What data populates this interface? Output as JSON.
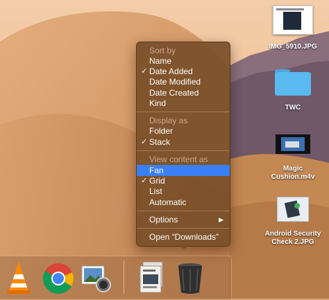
{
  "context_menu": {
    "sort_by": {
      "header": "Sort by",
      "items": [
        {
          "label": "Name",
          "checked": false
        },
        {
          "label": "Date Added",
          "checked": true
        },
        {
          "label": "Date Modified",
          "checked": false
        },
        {
          "label": "Date Created",
          "checked": false
        },
        {
          "label": "Kind",
          "checked": false
        }
      ]
    },
    "display_as": {
      "header": "Display as",
      "items": [
        {
          "label": "Folder",
          "checked": false
        },
        {
          "label": "Stack",
          "checked": true
        }
      ]
    },
    "view_content_as": {
      "header": "View content as",
      "items": [
        {
          "label": "Fan",
          "checked": false,
          "highlighted": true
        },
        {
          "label": "Grid",
          "checked": true
        },
        {
          "label": "List",
          "checked": false
        },
        {
          "label": "Automatic",
          "checked": false
        }
      ]
    },
    "options": {
      "label": "Options"
    },
    "open": {
      "label": "Open “Downloads”"
    },
    "check_glyph": "✓",
    "submenu_glyph": "▶",
    "highlight_color": "#3a7ff3"
  },
  "desktop_icons": [
    {
      "name": "IMG_5910.JPG",
      "type": "image-file"
    },
    {
      "name": "TWC",
      "type": "folder"
    },
    {
      "name": "Magic Cushion.m4v",
      "type": "video-file"
    },
    {
      "name": "Android Security Check 2.JPG",
      "type": "image-file"
    }
  ],
  "dock": {
    "items": [
      {
        "name": "vlc-icon"
      },
      {
        "name": "chrome-icon"
      },
      {
        "name": "preview-icon"
      },
      {
        "name": "downloads-stack-icon"
      },
      {
        "name": "trash-icon"
      }
    ]
  }
}
